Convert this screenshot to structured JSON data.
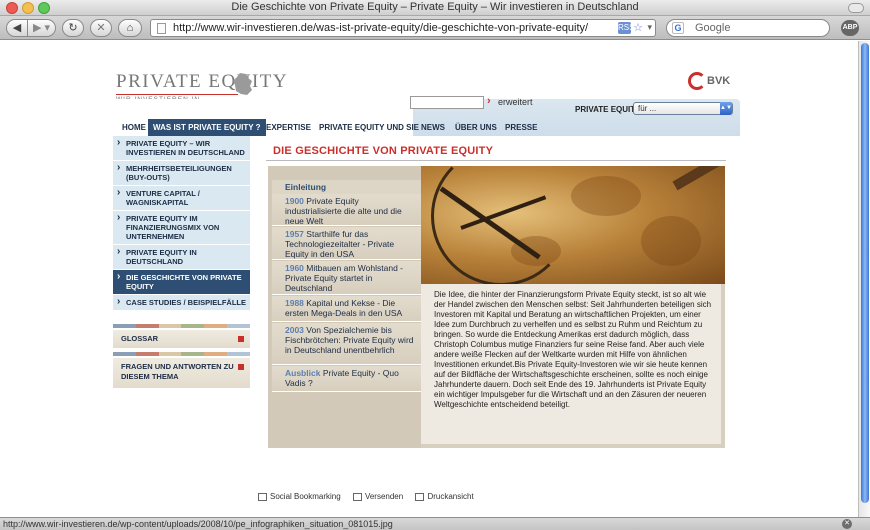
{
  "window": {
    "title": "Die Geschichte von Private Equity – Private Equity – Wir investieren in Deutschland"
  },
  "browser": {
    "url": "http://www.wir-investieren.de/was-ist-private-equity/die-geschichte-von-private-equity/",
    "search_placeholder": "Google",
    "abp_label": "ABP",
    "google_badge": "G",
    "rss_badge": "RSS",
    "status": "http://www.wir-investieren.de/wp-content/uploads/2008/10/pe_infographiken_situation_081015.jpg"
  },
  "site": {
    "logo_main": "PRIVATE EQUITY",
    "logo_sub": "WIR INVESTIEREN IN DEUTSCHLAND",
    "bvk": "BVK",
    "search_extended": "erweitert",
    "search_go": "›",
    "pe_label": "PRIVATE EQUITY:",
    "pe_select": "für ...",
    "nav": [
      {
        "label": "HOME"
      },
      {
        "label": "WAS IST PRIVATE EQUITY ?"
      },
      {
        "label": "EXPERTISE"
      },
      {
        "label": "PRIVATE EQUITY UND SIE"
      },
      {
        "label": "NEWS"
      },
      {
        "label": "ÜBER UNS"
      },
      {
        "label": "PRESSE"
      }
    ]
  },
  "sidebar": {
    "items": [
      {
        "label": "PRIVATE EQUITY – WIR INVESTIEREN IN DEUTSCHLAND"
      },
      {
        "label": "MEHRHEITSBETEILIGUNGEN (BUY-OUTS)"
      },
      {
        "label": "VENTURE CAPITAL / WAGNISKAPITAL"
      },
      {
        "label": "PRIVATE EQUITY IM FINANZIERUNGSMIX VON UNTERNEHMEN"
      },
      {
        "label": "PRIVATE EQUITY IN DEUTSCHLAND"
      },
      {
        "label": "DIE GESCHICHTE VON PRIVATE EQUITY"
      },
      {
        "label": "CASE STUDIES / BEISPIELFÄLLE"
      }
    ],
    "glossar": "GLOSSAR",
    "faq": "FRAGEN UND ANTWORTEN ZU DIESEM THEMA"
  },
  "main": {
    "title": "DIE GESCHICHTE VON PRIVATE EQUITY",
    "intro": "Einleitung",
    "timeline": [
      {
        "year": "1900",
        "text": "Private Equity industrialisierte die alte und die neue Welt"
      },
      {
        "year": "1957",
        "text": "Starthilfe fur das Technologiezeitalter - Private Equity in den USA"
      },
      {
        "year": "1960",
        "text": "Mitbauen am Wohlstand - Private Equity startet in Deutschland"
      },
      {
        "year": "1988",
        "text": "Kapital und Kekse - Die ersten Mega-Deals in den USA"
      },
      {
        "year": "2003",
        "text": "Von Spezialchemie bis Fischbrötchen: Private Equity wird in Deutschland unentbehrlich"
      },
      {
        "year": "Ausblick",
        "text": "Private Equity - Quo Vadis ?"
      }
    ],
    "body": "Die Idee, die hinter der Finanzierungsform Private Equity steckt, ist so alt wie der Handel zwischen den Menschen selbst: Seit Jahrhunderten beteiligen sich Investoren mit Kapital und Beratung an wirtschaftlichen Projekten, um einer Idee zum Durchbruch zu verhelfen und es selbst zu Ruhm und Reichtum zu bringen. So wurde die Entdeckung Amerikas erst dadurch möglich, dass Christoph Columbus mutige Finanziers fur seine Reise fand. Aber auch viele andere weiße Flecken auf der Weltkarte wurden mit Hilfe von ähnlichen Investitionen erkundet.Bis Private Equity-Investoren wie wir sie heute kennen auf der Bildfläche der Wirtschaftsgeschichte erscheinen, sollte es noch einige Jahrhunderte dauern. Doch seit Ende des 19. Jahrhunderts ist Private Equity ein wichtiger Impulsgeber fur die Wirtschaft und an den Zäsuren der neueren Weltgeschichte entscheidend beteiligt."
  },
  "footer": {
    "bookmark": "Social Bookmarking",
    "send": "Versenden",
    "print": "Druckansicht"
  },
  "colors": {
    "accent_red": "#c9302c",
    "nav_blue": "#2e4f73",
    "light_blue": "#dae8f1",
    "beige": "#e3dccd"
  }
}
